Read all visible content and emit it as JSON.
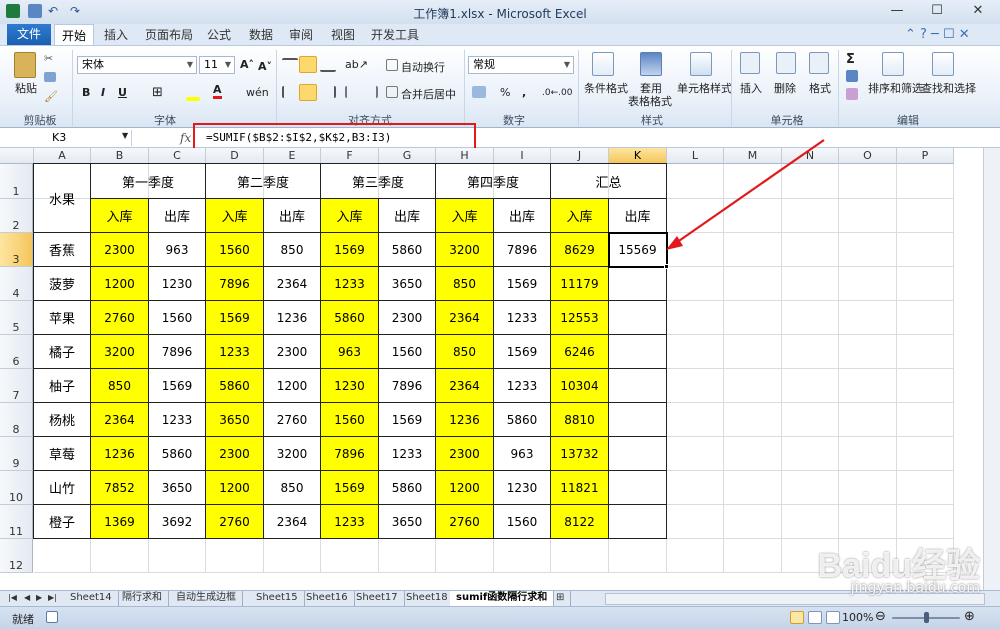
{
  "window": {
    "title": "工作簿1.xlsx - Microsoft Excel",
    "minimize_glyph": "—",
    "maximize_glyph": "☐",
    "close_glyph": "✕"
  },
  "menu": {
    "file": "文件",
    "tabs": [
      "开始",
      "插入",
      "页面布局",
      "公式",
      "数据",
      "审阅",
      "视图",
      "开发工具"
    ],
    "active_tab": "开始"
  },
  "ribbon": {
    "clipboard": {
      "paste": "粘贴",
      "group": "剪贴板"
    },
    "font": {
      "name": "宋体",
      "size": "11",
      "bold": "B",
      "italic": "I",
      "underline": "U",
      "group": "字体"
    },
    "align": {
      "wrap": "自动换行",
      "merge": "合并后居中",
      "group": "对齐方式"
    },
    "number": {
      "format": "常规",
      "percent": "%",
      "comma": ",",
      "group": "数字"
    },
    "styles": {
      "conditional": "条件格式",
      "table1": "套用",
      "table2": "表格格式",
      "cell_style": "单元格样式",
      "group": "样式"
    },
    "cells": {
      "insert": "插入",
      "delete": "删除",
      "format": "格式",
      "group": "单元格"
    },
    "editing": {
      "sort": "排序和筛选",
      "find": "查找和选择",
      "group": "编辑",
      "sigma": "Σ"
    }
  },
  "formula_bar": {
    "name_box": "K3",
    "fx": "fx",
    "formula": "=SUMIF($B$2:$I$2,$K$2,B3:I3)"
  },
  "sheet": {
    "columns": [
      "A",
      "B",
      "C",
      "D",
      "E",
      "F",
      "G",
      "H",
      "I",
      "J",
      "K",
      "L",
      "M",
      "N",
      "O",
      "P"
    ],
    "rows": [
      "1",
      "2",
      "3",
      "4",
      "5",
      "6",
      "7",
      "8",
      "9",
      "10",
      "11",
      "12"
    ],
    "selected_col": "K",
    "selected_row": "3",
    "header_fruit": "水果",
    "quarters": [
      "第一季度",
      "第二季度",
      "第三季度",
      "第四季度",
      "汇总"
    ],
    "in_label": "入库",
    "out_label": "出库",
    "data": [
      {
        "fruit": "香蕉",
        "v": [
          "2300",
          "963",
          "1560",
          "850",
          "1569",
          "5860",
          "3200",
          "7896",
          "8629",
          "15569"
        ]
      },
      {
        "fruit": "菠萝",
        "v": [
          "1200",
          "1230",
          "7896",
          "2364",
          "1233",
          "3650",
          "850",
          "1569",
          "11179",
          ""
        ]
      },
      {
        "fruit": "苹果",
        "v": [
          "2760",
          "1560",
          "1569",
          "1236",
          "5860",
          "2300",
          "2364",
          "1233",
          "12553",
          ""
        ]
      },
      {
        "fruit": "橘子",
        "v": [
          "3200",
          "7896",
          "1233",
          "2300",
          "963",
          "1560",
          "850",
          "1569",
          "6246",
          ""
        ]
      },
      {
        "fruit": "柚子",
        "v": [
          "850",
          "1569",
          "5860",
          "1200",
          "1230",
          "7896",
          "2364",
          "1233",
          "10304",
          ""
        ]
      },
      {
        "fruit": "杨桃",
        "v": [
          "2364",
          "1233",
          "3650",
          "2760",
          "1560",
          "1569",
          "1236",
          "5860",
          "8810",
          ""
        ]
      },
      {
        "fruit": "草莓",
        "v": [
          "1236",
          "5860",
          "2300",
          "3200",
          "7896",
          "1233",
          "2300",
          "963",
          "13732",
          ""
        ]
      },
      {
        "fruit": "山竹",
        "v": [
          "7852",
          "3650",
          "1200",
          "850",
          "1569",
          "5860",
          "1200",
          "1230",
          "11821",
          ""
        ]
      },
      {
        "fruit": "橙子",
        "v": [
          "1369",
          "3692",
          "2760",
          "2364",
          "1233",
          "3650",
          "2760",
          "1560",
          "8122",
          ""
        ]
      }
    ]
  },
  "sheet_tabs": [
    "Sheet14",
    "隔行求和",
    "自动生成边框",
    "Sheet15",
    "Sheet16",
    "Sheet17",
    "Sheet18",
    "sumif函数隔行求和"
  ],
  "active_sheet_tab": "sumif函数隔行求和",
  "status": {
    "ready": "就绪",
    "zoom": "100%"
  },
  "watermark": {
    "brand": "Baidu经验",
    "url": "jingyan.baidu.com"
  },
  "colors": {
    "highlight": "#ffff00",
    "annotation": "#e0191b",
    "file_tab": "#1b5fb0"
  }
}
